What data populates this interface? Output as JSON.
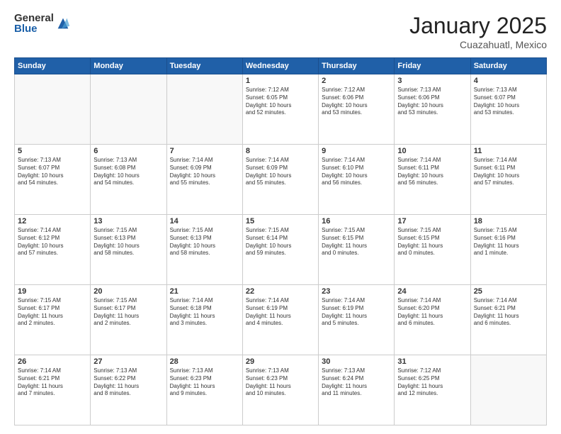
{
  "header": {
    "logo_general": "General",
    "logo_blue": "Blue",
    "title": "January 2025",
    "location": "Cuazahuatl, Mexico"
  },
  "days_of_week": [
    "Sunday",
    "Monday",
    "Tuesday",
    "Wednesday",
    "Thursday",
    "Friday",
    "Saturday"
  ],
  "weeks": [
    [
      {
        "day": "",
        "text": ""
      },
      {
        "day": "",
        "text": ""
      },
      {
        "day": "",
        "text": ""
      },
      {
        "day": "1",
        "text": "Sunrise: 7:12 AM\nSunset: 6:05 PM\nDaylight: 10 hours\nand 52 minutes."
      },
      {
        "day": "2",
        "text": "Sunrise: 7:12 AM\nSunset: 6:06 PM\nDaylight: 10 hours\nand 53 minutes."
      },
      {
        "day": "3",
        "text": "Sunrise: 7:13 AM\nSunset: 6:06 PM\nDaylight: 10 hours\nand 53 minutes."
      },
      {
        "day": "4",
        "text": "Sunrise: 7:13 AM\nSunset: 6:07 PM\nDaylight: 10 hours\nand 53 minutes."
      }
    ],
    [
      {
        "day": "5",
        "text": "Sunrise: 7:13 AM\nSunset: 6:07 PM\nDaylight: 10 hours\nand 54 minutes."
      },
      {
        "day": "6",
        "text": "Sunrise: 7:13 AM\nSunset: 6:08 PM\nDaylight: 10 hours\nand 54 minutes."
      },
      {
        "day": "7",
        "text": "Sunrise: 7:14 AM\nSunset: 6:09 PM\nDaylight: 10 hours\nand 55 minutes."
      },
      {
        "day": "8",
        "text": "Sunrise: 7:14 AM\nSunset: 6:09 PM\nDaylight: 10 hours\nand 55 minutes."
      },
      {
        "day": "9",
        "text": "Sunrise: 7:14 AM\nSunset: 6:10 PM\nDaylight: 10 hours\nand 56 minutes."
      },
      {
        "day": "10",
        "text": "Sunrise: 7:14 AM\nSunset: 6:11 PM\nDaylight: 10 hours\nand 56 minutes."
      },
      {
        "day": "11",
        "text": "Sunrise: 7:14 AM\nSunset: 6:11 PM\nDaylight: 10 hours\nand 57 minutes."
      }
    ],
    [
      {
        "day": "12",
        "text": "Sunrise: 7:14 AM\nSunset: 6:12 PM\nDaylight: 10 hours\nand 57 minutes."
      },
      {
        "day": "13",
        "text": "Sunrise: 7:15 AM\nSunset: 6:13 PM\nDaylight: 10 hours\nand 58 minutes."
      },
      {
        "day": "14",
        "text": "Sunrise: 7:15 AM\nSunset: 6:13 PM\nDaylight: 10 hours\nand 58 minutes."
      },
      {
        "day": "15",
        "text": "Sunrise: 7:15 AM\nSunset: 6:14 PM\nDaylight: 10 hours\nand 59 minutes."
      },
      {
        "day": "16",
        "text": "Sunrise: 7:15 AM\nSunset: 6:15 PM\nDaylight: 11 hours\nand 0 minutes."
      },
      {
        "day": "17",
        "text": "Sunrise: 7:15 AM\nSunset: 6:15 PM\nDaylight: 11 hours\nand 0 minutes."
      },
      {
        "day": "18",
        "text": "Sunrise: 7:15 AM\nSunset: 6:16 PM\nDaylight: 11 hours\nand 1 minute."
      }
    ],
    [
      {
        "day": "19",
        "text": "Sunrise: 7:15 AM\nSunset: 6:17 PM\nDaylight: 11 hours\nand 2 minutes."
      },
      {
        "day": "20",
        "text": "Sunrise: 7:15 AM\nSunset: 6:17 PM\nDaylight: 11 hours\nand 2 minutes."
      },
      {
        "day": "21",
        "text": "Sunrise: 7:14 AM\nSunset: 6:18 PM\nDaylight: 11 hours\nand 3 minutes."
      },
      {
        "day": "22",
        "text": "Sunrise: 7:14 AM\nSunset: 6:19 PM\nDaylight: 11 hours\nand 4 minutes."
      },
      {
        "day": "23",
        "text": "Sunrise: 7:14 AM\nSunset: 6:19 PM\nDaylight: 11 hours\nand 5 minutes."
      },
      {
        "day": "24",
        "text": "Sunrise: 7:14 AM\nSunset: 6:20 PM\nDaylight: 11 hours\nand 6 minutes."
      },
      {
        "day": "25",
        "text": "Sunrise: 7:14 AM\nSunset: 6:21 PM\nDaylight: 11 hours\nand 6 minutes."
      }
    ],
    [
      {
        "day": "26",
        "text": "Sunrise: 7:14 AM\nSunset: 6:21 PM\nDaylight: 11 hours\nand 7 minutes."
      },
      {
        "day": "27",
        "text": "Sunrise: 7:13 AM\nSunset: 6:22 PM\nDaylight: 11 hours\nand 8 minutes."
      },
      {
        "day": "28",
        "text": "Sunrise: 7:13 AM\nSunset: 6:23 PM\nDaylight: 11 hours\nand 9 minutes."
      },
      {
        "day": "29",
        "text": "Sunrise: 7:13 AM\nSunset: 6:23 PM\nDaylight: 11 hours\nand 10 minutes."
      },
      {
        "day": "30",
        "text": "Sunrise: 7:13 AM\nSunset: 6:24 PM\nDaylight: 11 hours\nand 11 minutes."
      },
      {
        "day": "31",
        "text": "Sunrise: 7:12 AM\nSunset: 6:25 PM\nDaylight: 11 hours\nand 12 minutes."
      },
      {
        "day": "",
        "text": ""
      }
    ]
  ]
}
